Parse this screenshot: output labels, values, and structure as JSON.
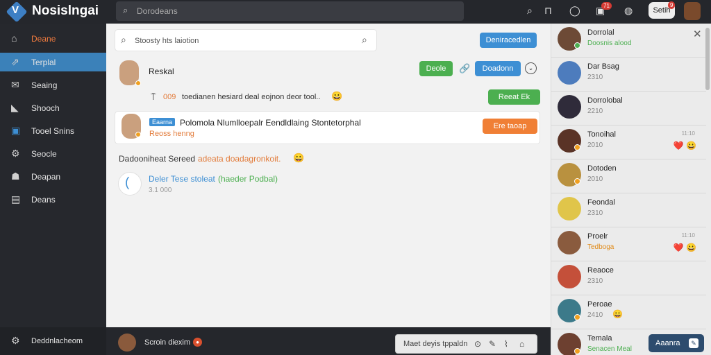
{
  "app": {
    "name": "Nosislngai",
    "logo_glyph": "V"
  },
  "topbar": {
    "search_placeholder": "Dorodeans",
    "badge_alerts": "71",
    "badge_profile": "9",
    "profile_button_label": "Setih"
  },
  "sidebar": {
    "items": [
      {
        "label": "Deane",
        "icon": "home-icon"
      },
      {
        "label": "Terplal",
        "icon": "chart-icon"
      },
      {
        "label": "Seaing",
        "icon": "mail-icon"
      },
      {
        "label": "Shooch",
        "icon": "tag-icon"
      },
      {
        "label": "Tooel Snins",
        "icon": "monitor-icon"
      },
      {
        "label": "Seocle",
        "icon": "gear-icon"
      },
      {
        "label": "Deapan",
        "icon": "person-icon"
      },
      {
        "label": "Deans",
        "icon": "list-icon"
      }
    ],
    "footer_label": "Deddnlacheom"
  },
  "main": {
    "search_placeholder": "Stoosty hts laiotion",
    "search_button": "Deniracedlen",
    "post1": {
      "name": "Reskal",
      "button_green": "Deole",
      "button_blue": "Doadonn",
      "meta_number": "009",
      "message": "toedianen hesiard deal eojnon deor tool..",
      "emoji": "😀",
      "action_button": "Reeat Ek"
    },
    "post2": {
      "tag": "Eaarna",
      "title": "Polomola Nlumlloepalr Eendldlaing Stontetorphal",
      "subtitle": "Reoss henng",
      "action_button": "Ere taoap"
    },
    "status_line": {
      "prefix": "Dadooniheat  Sereed",
      "highlight": "adeata doadagronkoit.",
      "emoji": "😀"
    },
    "share": {
      "title": "Deler Tese stoleat",
      "suffix": "(haeder Podbal)",
      "time": "3.1 000"
    }
  },
  "composer": {
    "user_label": "Scroin diexim",
    "placeholder": "Maet deyis tppaldn"
  },
  "contacts": [
    {
      "name": "Dorrolal",
      "status": "Doosnis alood",
      "status_color": "#4caf50",
      "time": "",
      "reaction": ""
    },
    {
      "name": "Dar Bsag",
      "status": "2310",
      "status_color": "#888888",
      "time": "",
      "reaction": ""
    },
    {
      "name": "Dorrolobal",
      "status": "2210",
      "status_color": "#888888",
      "time": "",
      "reaction": ""
    },
    {
      "name": "Tonoihal",
      "status": "2010",
      "status_color": "#888888",
      "time": "11:10",
      "reaction": "❤️ 😀"
    },
    {
      "name": "Dotoden",
      "status": "2010",
      "status_color": "#888888",
      "time": "",
      "reaction": ""
    },
    {
      "name": "Feondal",
      "status": "2310",
      "status_color": "#888888",
      "time": "",
      "reaction": ""
    },
    {
      "name": "Proelr",
      "status": "Tedboga",
      "status_color": "#e08a18",
      "time": "11:10",
      "reaction": "❤️ 😀"
    },
    {
      "name": "Reaoce",
      "status": "2310",
      "status_color": "#888888",
      "time": "",
      "reaction": ""
    },
    {
      "name": "Peroae",
      "status": "2410",
      "status_color": "#888888",
      "time": "",
      "reaction": "😀"
    },
    {
      "name": "Temala",
      "status": "Senacen Meal",
      "status_color": "#4caf50",
      "time": "",
      "reaction": ""
    }
  ],
  "right_footer_button": "Aaanra",
  "colors": {
    "accent": "#3d81b9",
    "green": "#4caf50",
    "orange": "#f07f35",
    "dark": "#26282d"
  }
}
